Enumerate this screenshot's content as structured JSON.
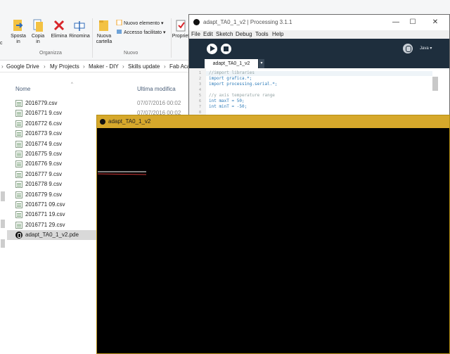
{
  "explorer": {
    "ribbon": {
      "move_to": [
        "Sposta",
        "in"
      ],
      "copy_to": [
        "Copia",
        "in"
      ],
      "delete": "Elimina",
      "rename": "Rinomina",
      "new_folder": [
        "Nuova",
        "cartella"
      ],
      "new_item": "Nuovo elemento",
      "easy_access": "Accesso facilitato",
      "properties": "Propriet",
      "group_organize": "Organizza",
      "group_new": "Nuovo",
      "left_edge": "c"
    },
    "breadcrumbs": [
      "Google Drive",
      "My Projects",
      "Maker - DIY",
      "Skills update",
      "Fab Aca"
    ],
    "columns": {
      "name": "Nome",
      "modified": "Ultima modifica"
    },
    "files": [
      {
        "name": "2016779.csv",
        "date": "07/07/2016 00:02"
      },
      {
        "name": "2016771 9.csv",
        "date": "07/07/2016 00:02"
      },
      {
        "name": "2016772 6.csv",
        "date": ""
      },
      {
        "name": "2016773 9.csv",
        "date": ""
      },
      {
        "name": "2016774 9.csv",
        "date": ""
      },
      {
        "name": "2016775 9.csv",
        "date": ""
      },
      {
        "name": "2016776 9.csv",
        "date": ""
      },
      {
        "name": "2016777 9.csv",
        "date": ""
      },
      {
        "name": "2016778 9.csv",
        "date": ""
      },
      {
        "name": "2016779 9.csv",
        "date": ""
      },
      {
        "name": "2016771 09.csv",
        "date": ""
      },
      {
        "name": "2016771 19.csv",
        "date": ""
      },
      {
        "name": "2016771 29.csv",
        "date": ""
      }
    ],
    "selected_file": "adapt_TA0_1_v2.pde"
  },
  "ide": {
    "title": "adapt_TA0_1_v2 | Processing 3.1.1",
    "menu": [
      "File",
      "Edit",
      "Sketch",
      "Debug",
      "Tools",
      "Help"
    ],
    "mode": "Java ▾",
    "tab": "adapt_TA0_1_v2",
    "tab_menu": "▾",
    "line_numbers": [
      "1",
      "2",
      "3",
      "4",
      "5",
      "6",
      "7",
      "8"
    ],
    "code": [
      "//import libraries",
      "import grafica.*;",
      "import processing.serial.*;",
      "",
      "//y axis temperature range",
      "int maxT = 50;",
      "int minT = -50;",
      ""
    ]
  },
  "sketch": {
    "title": "adapt_TA0_1_v2",
    "line_colors": [
      "#ffffff",
      "#d23a3a"
    ]
  }
}
